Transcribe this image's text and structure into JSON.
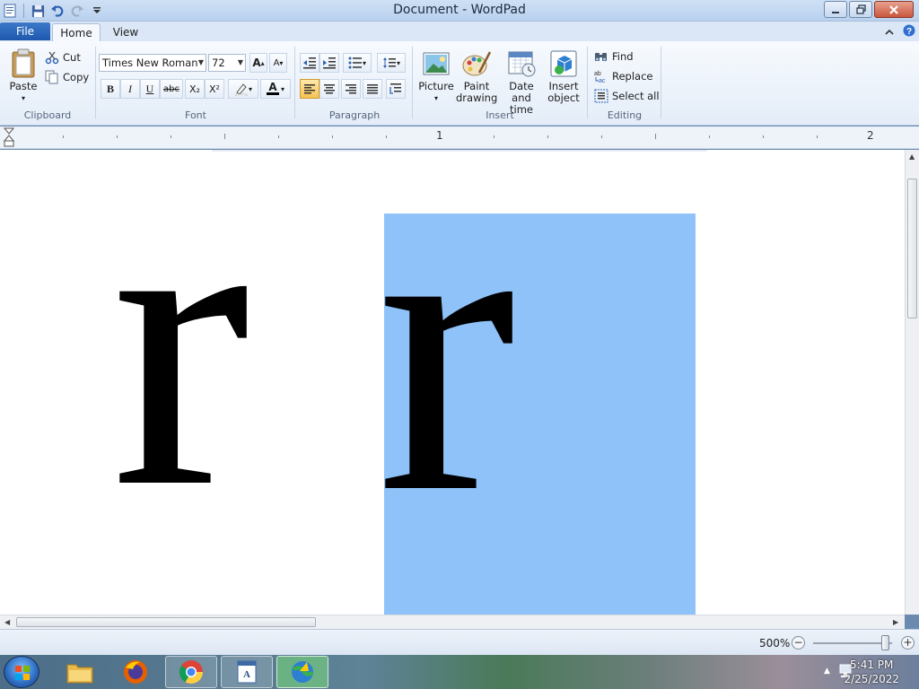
{
  "window": {
    "title": "Document - WordPad"
  },
  "tabs": {
    "file": "File",
    "home": "Home",
    "view": "View"
  },
  "clipboard": {
    "paste": "Paste",
    "cut": "Cut",
    "copy": "Copy",
    "label": "Clipboard"
  },
  "font": {
    "family": "Times New Roman",
    "size": "72",
    "label": "Font",
    "bold": "B",
    "italic": "I",
    "underline": "U",
    "strike": "abc",
    "subscript": "X₂",
    "superscript": "X²",
    "grow": "A",
    "shrink": "A",
    "color_letter": "A",
    "highlight_color": "#ffffff",
    "text_color": "#000000"
  },
  "paragraph": {
    "label": "Paragraph"
  },
  "insert": {
    "picture": "Picture",
    "paint_drawing": "Paint drawing",
    "date_time": "Date and time",
    "insert_object": "Insert object",
    "label": "Insert"
  },
  "editing": {
    "find": "Find",
    "replace": "Replace",
    "select_all": "Select all",
    "label": "Editing"
  },
  "ruler": {
    "num1": "1",
    "num2": "2"
  },
  "document": {
    "char1": "r",
    "char2": "r",
    "selection_color": "#8ec2f8"
  },
  "status": {
    "zoom": "500%",
    "zoom_minus": "−",
    "zoom_plus": "+"
  },
  "taskbar": {
    "time": "5:41 PM",
    "date": "2/25/2022"
  },
  "icons": [
    "save-icon",
    "undo-icon",
    "redo-icon",
    "customize-qat-icon",
    "paste-icon",
    "cut-icon",
    "copy-icon",
    "picture-icon",
    "paint-drawing-icon",
    "date-time-icon",
    "insert-object-icon",
    "find-icon",
    "replace-icon",
    "select-all-icon"
  ]
}
